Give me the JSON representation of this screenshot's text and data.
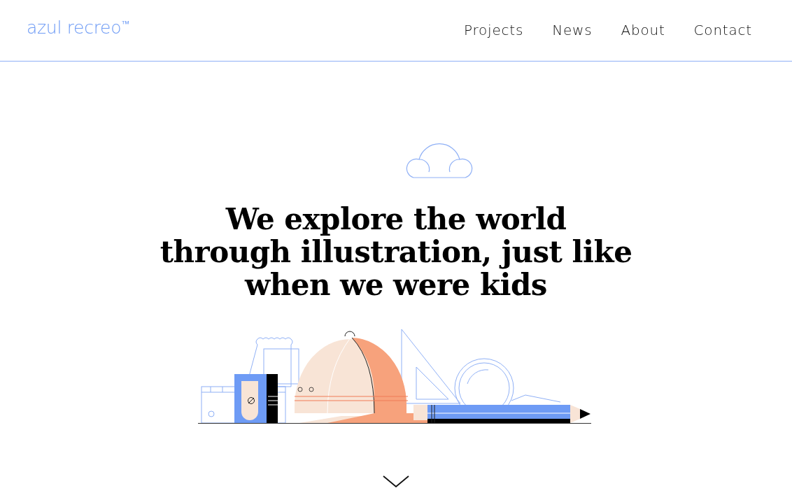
{
  "logo": {
    "name": "azul recreo",
    "mark": "™"
  },
  "nav": [
    {
      "label": "Projects"
    },
    {
      "label": "News"
    },
    {
      "label": "About"
    },
    {
      "label": "Contact"
    }
  ],
  "hero": {
    "headline": [
      "We explore the world",
      "through illustration, just like",
      "when we were kids"
    ]
  }
}
